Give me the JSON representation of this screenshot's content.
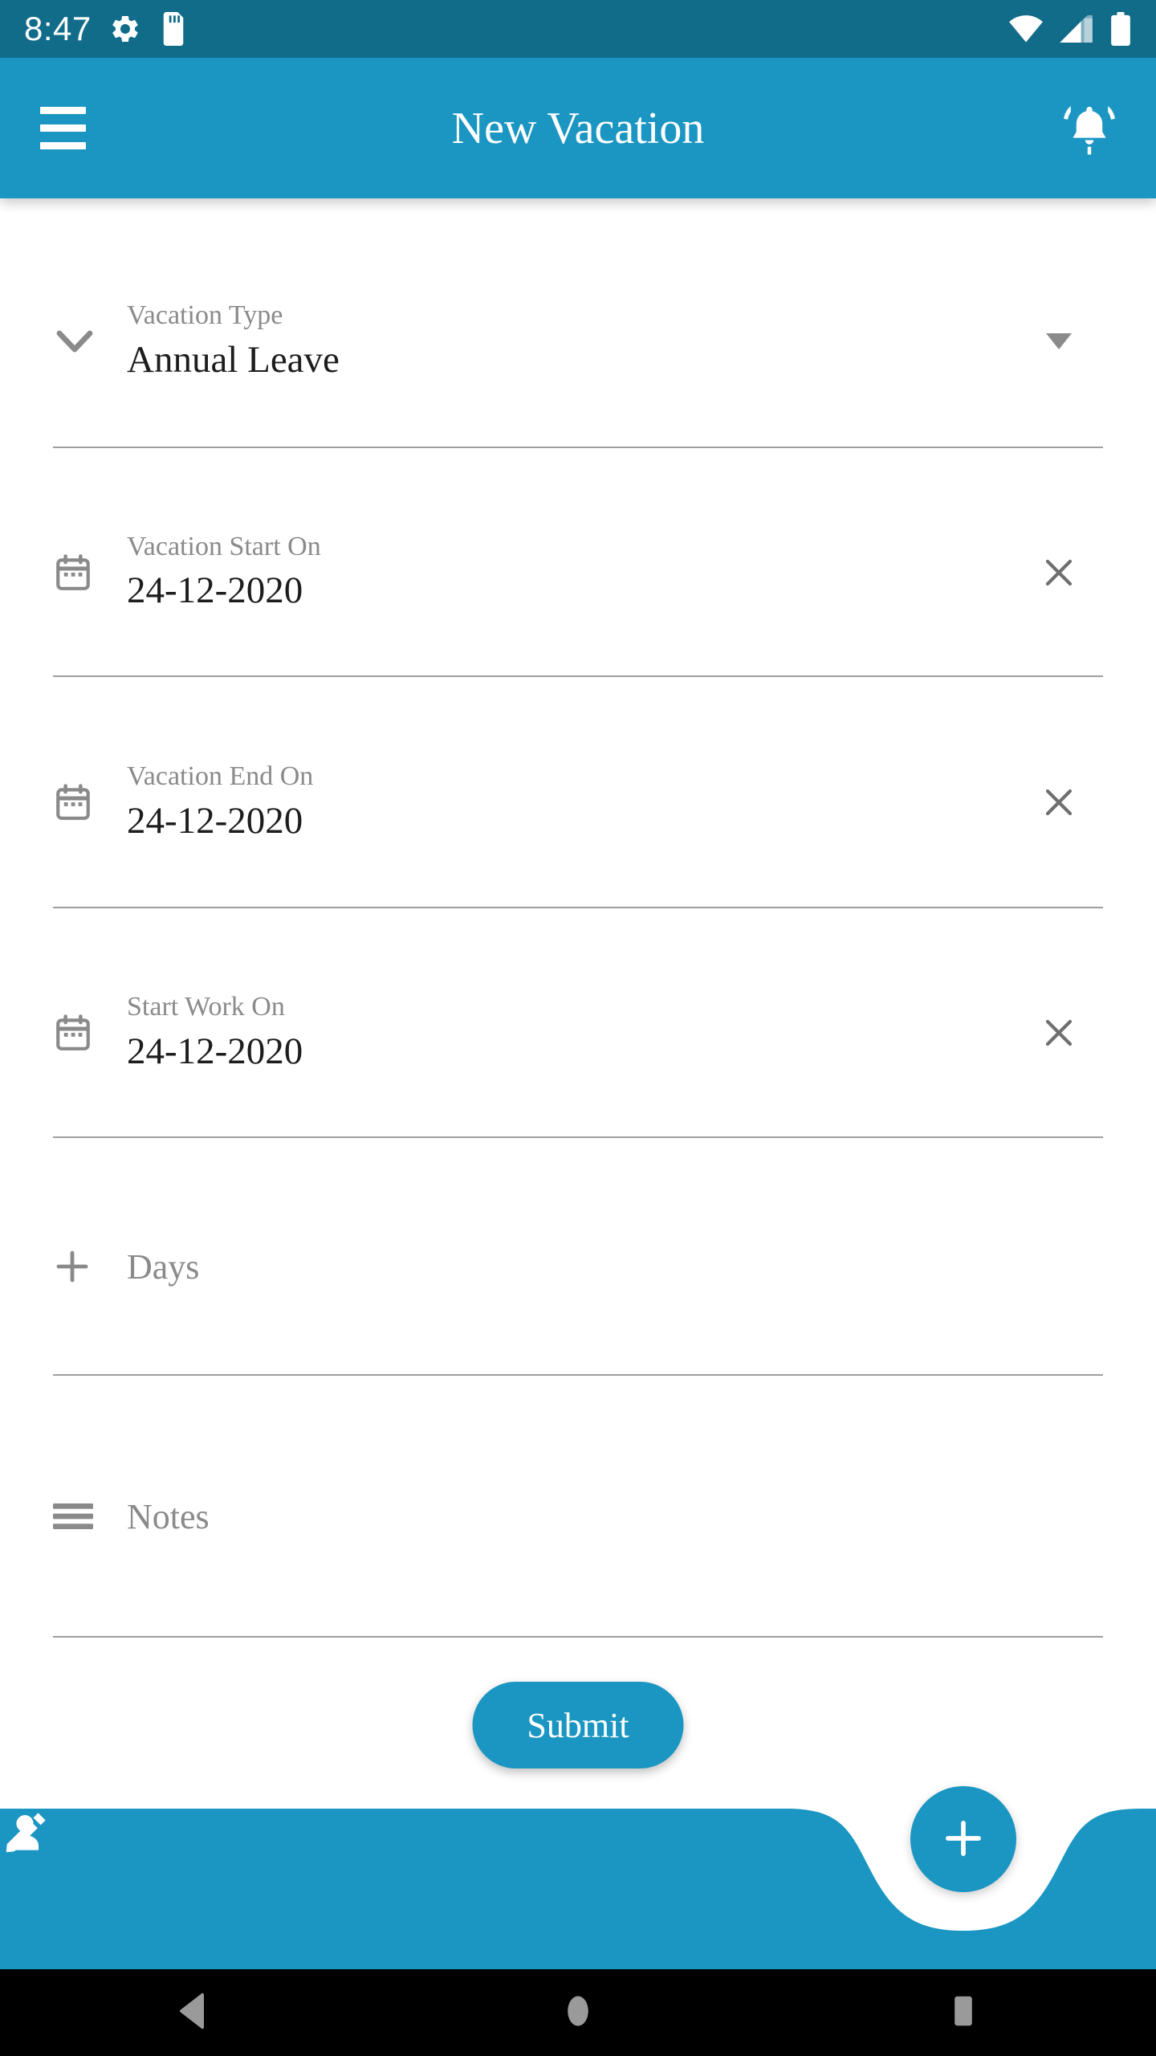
{
  "status_bar": {
    "time": "8:47",
    "left_icons": [
      "settings-gear-icon",
      "sd-card-icon"
    ],
    "right_icons": [
      "wifi-icon",
      "cellular-signal-icon",
      "battery-icon"
    ],
    "background_color": "#116C8A"
  },
  "app_bar": {
    "title": "New Vacation",
    "menu_icon": "hamburger-menu-icon",
    "notification_icon": "bell-ringing-icon",
    "background_color": "#1B96C2"
  },
  "form": {
    "vacation_type": {
      "label": "Vacation Type",
      "value": "Annual Leave",
      "leading_icon": "chevron-down-icon",
      "trailing_icon": "dropdown-arrow-icon"
    },
    "vacation_start": {
      "label": "Vacation Start On",
      "value": "24-12-2020",
      "leading_icon": "calendar-icon",
      "trailing_icon": "clear-x-icon"
    },
    "vacation_end": {
      "label": "Vacation End On",
      "value": "24-12-2020",
      "leading_icon": "calendar-icon",
      "trailing_icon": "clear-x-icon"
    },
    "start_work": {
      "label": "Start Work On",
      "value": "24-12-2020",
      "leading_icon": "calendar-icon",
      "trailing_icon": "clear-x-icon"
    },
    "days": {
      "placeholder": "Days",
      "value": "",
      "leading_icon": "plus-icon"
    },
    "notes": {
      "placeholder": "Notes",
      "value": "",
      "leading_icon": "list-lines-icon"
    },
    "submit_label": "Submit"
  },
  "bottom_nav": {
    "background_color": "#1B96C2",
    "items": [
      {
        "name": "profile",
        "icon": "person-icon"
      },
      {
        "name": "edit",
        "icon": "pencil-icon"
      }
    ],
    "fab": {
      "icon": "plus-icon",
      "color": "#1B96C2"
    }
  },
  "android_nav": {
    "back": "back-triangle-icon",
    "home": "home-circle-icon",
    "recents": "recents-square-icon",
    "icon_color": "#9a9a9a"
  }
}
